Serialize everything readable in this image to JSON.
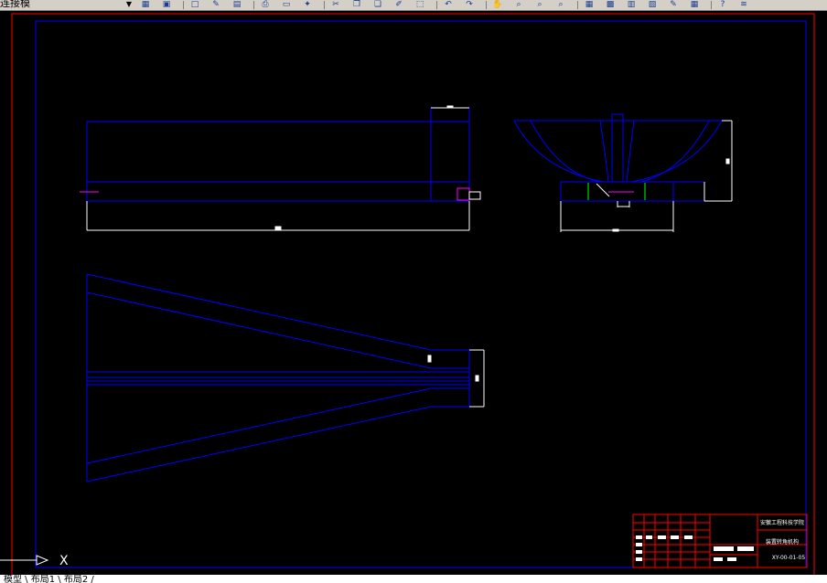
{
  "toolbar": {
    "layer_combo_value": "连接模",
    "buttons": [
      {
        "name": "layer-manager-icon",
        "glyph": "▦"
      },
      {
        "name": "layer-prev-icon",
        "glyph": "▣"
      },
      {
        "name": "new-icon",
        "glyph": "□"
      },
      {
        "name": "open-icon",
        "glyph": "✎"
      },
      {
        "name": "save-icon",
        "glyph": "▤"
      },
      {
        "name": "print-icon",
        "glyph": "⎙"
      },
      {
        "name": "plot-preview-icon",
        "glyph": "▭"
      },
      {
        "name": "publish-icon",
        "glyph": "✦"
      },
      {
        "name": "cut-icon",
        "glyph": "✂"
      },
      {
        "name": "copy-icon",
        "glyph": "❐"
      },
      {
        "name": "paste-icon",
        "glyph": "❏"
      },
      {
        "name": "match-properties-icon",
        "glyph": "✐"
      },
      {
        "name": "block-editor-icon",
        "glyph": "⬚"
      },
      {
        "name": "undo-icon",
        "glyph": "↶"
      },
      {
        "name": "redo-icon",
        "glyph": "↷"
      },
      {
        "name": "pan-icon",
        "glyph": "✋"
      },
      {
        "name": "zoom-realtime-icon",
        "glyph": "⌕"
      },
      {
        "name": "zoom-window-icon",
        "glyph": "⌕"
      },
      {
        "name": "zoom-previous-icon",
        "glyph": "⌕"
      },
      {
        "name": "properties-icon",
        "glyph": "▦"
      },
      {
        "name": "design-center-icon",
        "glyph": "▩"
      },
      {
        "name": "tool-palettes-icon",
        "glyph": "▥"
      },
      {
        "name": "sheet-set-icon",
        "glyph": "▧"
      },
      {
        "name": "markup-icon",
        "glyph": "✎"
      },
      {
        "name": "quickcalc-icon",
        "glyph": "▦"
      },
      {
        "name": "help-icon",
        "glyph": "?"
      },
      {
        "name": "layers-icon",
        "glyph": "≋"
      }
    ]
  },
  "title_block": {
    "school": "安徽工程科技学院",
    "drawing_name": "装置转角机构",
    "drawing_number": "XY-00-01-05"
  },
  "ucs": {
    "x_label": "X"
  },
  "command_line": {
    "text": "模型 \\ 布局1 \\ 布局2 /"
  },
  "colors": {
    "drawing_lines": "#0000ff",
    "dimensions": "#ffffff",
    "border_outer": "#ff0000",
    "centerline": "#ff00ff",
    "accent_green": "#00ff00",
    "title_grid": "#ff0000"
  }
}
